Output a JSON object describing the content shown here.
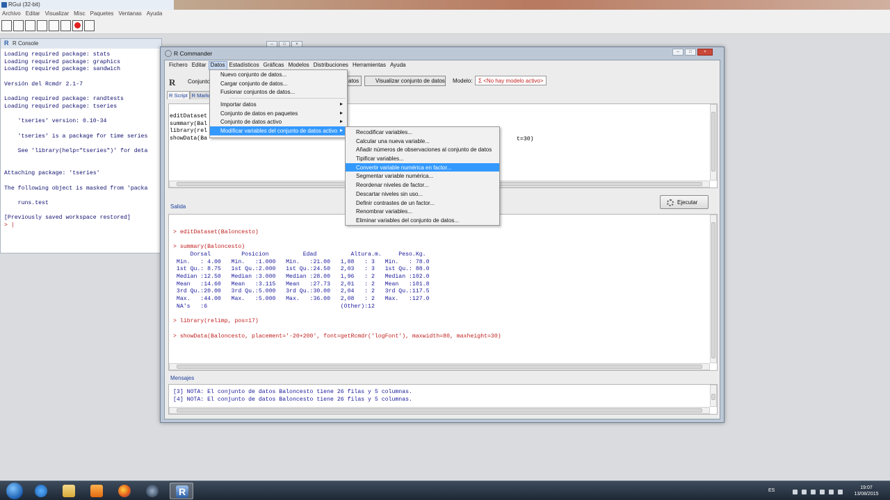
{
  "rgui": {
    "title": "RGui (32-bit)",
    "menu": [
      "Archivo",
      "Editar",
      "Visualizar",
      "Misc",
      "Paquetes",
      "Ventanas",
      "Ayuda"
    ],
    "toolbar_icons": [
      "open-script-icon",
      "load-workspace-icon",
      "save-workspace-icon",
      "copy-icon",
      "paste-icon",
      "copy-paste-icon",
      "stop-icon",
      "print-icon"
    ]
  },
  "console": {
    "title": "R Console",
    "lines": "Loading required package: stats\nLoading required package: graphics\nLoading required package: sandwich\n\nVersión del Rcmdr 2.1-7\n\nLoading required package: randtests\nLoading required package: tseries\n\n    'tseries' version: 0.10-34\n\n    'tseries' is a package for time series\n\n    See 'library(help=\"tseries\")' for deta\n\n\nAttaching package: 'tseries'\n\nThe following object is masked from 'packa\n\n    runs.test\n\n[Previously saved workspace restored]\n",
    "prompt": "> |"
  },
  "rcommander": {
    "title": "R Commander",
    "menu": [
      "Fichero",
      "Editar",
      "Datos",
      "Estadísticos",
      "Gráficas",
      "Modelos",
      "Distribuciones",
      "Herramientas",
      "Ayuda"
    ],
    "open_menu": "Datos",
    "dataset_label": "Conjunto",
    "edit_button": "Editar conjunto de datos",
    "edit_button_visible": "atos",
    "view_button": "Visualizar conjunto de datos",
    "model_label": "Modelo:",
    "model_value": "Σ <No hay modelo activo>",
    "tabs": [
      "R Script",
      "R Markd"
    ],
    "script_text": "editDataset\nsummary(Bal\nlibrary(rel\nshowData(Ba",
    "script_tail": "t=30)",
    "output_label": "Salida",
    "execute_button": "Ejecutar",
    "messages_label": "Mensajes",
    "output": [
      {
        "cmd": "> editDataset(Baloncesto)",
        "text": ""
      },
      {
        "cmd": "> summary(Baloncesto)",
        "text": "     Dorsal         Posicion          Edad          Altura.m.     Peso.Kg.  \n Min.   : 4.00   Min.   :1.000   Min.   :21.00   1,88   : 3   Min.   : 78.0  \n 1st Qu.: 8.75   1st Qu.:2.000   1st Qu.:24.50   2,03   : 3   1st Qu.: 88.0  \n Median :12.50   Median :3.000   Median :28.00   1,96   : 2   Median :102.0  \n Mean   :14.60   Mean   :3.115   Mean   :27.73   2,01   : 2   Mean   :101.8  \n 3rd Qu.:20.00   3rd Qu.:5.000   3rd Qu.:30.00   2,04   : 2   3rd Qu.:117.5  \n Max.   :44.00   Max.   :5.000   Max.   :36.00   2,08   : 2   Max.   :127.0  \n NA's   :6                                       (Other):12                  "
      },
      {
        "cmd": "> library(relimp, pos=17)",
        "text": ""
      },
      {
        "cmd": "> showData(Baloncesto, placement='-20+200', font=getRcmdr('logFont'), maxwidth=80, maxheight=30)",
        "text": ""
      }
    ],
    "messages": "[3] NOTA: El conjunto de datos Baloncesto tiene 26 filas y 5 columnas.\n[4] NOTA: El conjunto de datos Baloncesto tiene 26 filas y 5 columnas."
  },
  "datos_menu": [
    {
      "label": "Nuevo conjunto de datos...",
      "submenu": false
    },
    {
      "label": "Cargar conjunto de datos...",
      "submenu": false
    },
    {
      "label": "Fusionar conjuntos de datos...",
      "submenu": false
    },
    {
      "label": "Importar datos",
      "submenu": true
    },
    {
      "label": "Conjunto de datos en paquetes",
      "submenu": true
    },
    {
      "label": "Conjunto de datos activo",
      "submenu": true
    },
    {
      "label": "Modificar variables del conjunto de datos activo",
      "submenu": true,
      "highlighted": true
    }
  ],
  "modificar_menu": [
    "Recodificar variables...",
    "Calcular una nueva variable...",
    "Añadir números de observaciones al conjunto de datos",
    "Tipificar variables...",
    "Convertir variable numérica en factor...",
    "Segmentar variable numérica...",
    "Reordenar niveles de factor...",
    "Descartar niveles sin uso...",
    "Definir contrastes de un factor...",
    "Renombrar variables...",
    "Eliminar variables del conjunto de datos..."
  ],
  "modificar_highlighted_index": 4,
  "taskbar": {
    "language": "ES",
    "time": "19:07",
    "date": "13/08/2015",
    "apps": [
      "internet-explorer-icon",
      "file-explorer-icon",
      "media-player-icon",
      "firefox-icon",
      "steam-icon",
      "r-icon"
    ],
    "active_app": "r-icon"
  },
  "colors": {
    "menu_highlight": "#3399ff",
    "output_command": "#c02020",
    "output_text": "#1a1a9c",
    "model_value": "#c02020"
  }
}
